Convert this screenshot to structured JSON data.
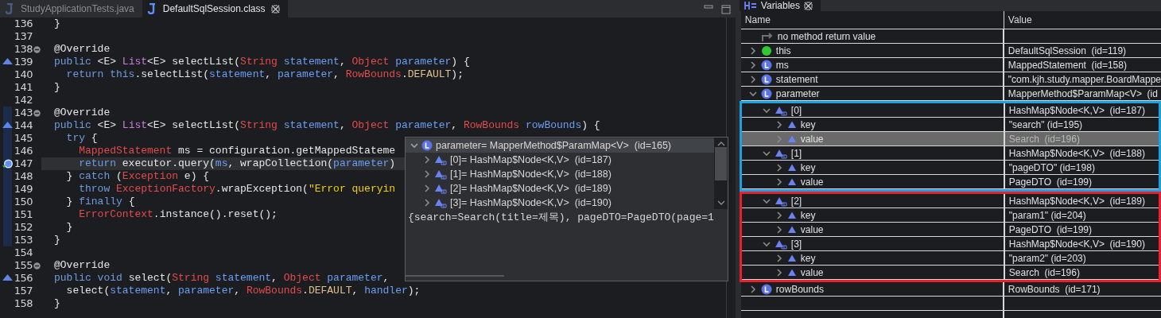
{
  "editor": {
    "tabs": [
      {
        "label": "StudyApplicationTests.java",
        "selected": false,
        "closable": false
      },
      {
        "label": "DefaultSqlSession.class",
        "selected": true,
        "closable": true
      }
    ],
    "lines": [
      {
        "number": "136",
        "fold": false,
        "scope": false,
        "current": false,
        "tokens": [
          {
            "kind": "plain",
            "text": "}"
          }
        ]
      },
      {
        "number": "137",
        "fold": false,
        "scope": false,
        "current": false
      },
      {
        "number": "138",
        "fold": true,
        "scope": false,
        "current": false,
        "tokens": [
          {
            "kind": "plain",
            "text": "@Override"
          }
        ]
      },
      {
        "number": "139",
        "fold": false,
        "marker": {
          "kind": "override"
        },
        "scope": false,
        "current": false,
        "tokens": [
          {
            "kind": "keyword",
            "text": "public"
          },
          {
            "kind": "plain",
            "text": " <E> "
          },
          {
            "kind": "generic",
            "text": "List"
          },
          {
            "kind": "plain",
            "text": "<E> selectList("
          },
          {
            "kind": "type",
            "text": "String"
          },
          {
            "kind": "variable",
            "text": " statement"
          },
          {
            "kind": "plain",
            "text": ", "
          },
          {
            "kind": "type",
            "text": "Object"
          },
          {
            "kind": "variable",
            "text": " parameter"
          },
          {
            "kind": "plain",
            "text": ") {"
          }
        ]
      },
      {
        "number": "140",
        "fold": false,
        "scope": false,
        "current": false,
        "tokens": [
          {
            "kind": "keyword",
            "text": "  return this"
          },
          {
            "kind": "plain",
            "text": ".selectList("
          },
          {
            "kind": "variable",
            "text": "statement"
          },
          {
            "kind": "plain",
            "text": ", "
          },
          {
            "kind": "variable",
            "text": "parameter"
          },
          {
            "kind": "plain",
            "text": ", "
          },
          {
            "kind": "type",
            "text": "RowBounds"
          },
          {
            "kind": "plain",
            "text": "."
          },
          {
            "kind": "constant",
            "text": "DEFAULT"
          },
          {
            "kind": "plain",
            "text": ");"
          }
        ]
      },
      {
        "number": "141",
        "fold": false,
        "scope": false,
        "current": false,
        "tokens": [
          {
            "kind": "plain",
            "text": "}"
          }
        ]
      },
      {
        "number": "142",
        "fold": false,
        "scope": false,
        "current": false
      },
      {
        "number": "143",
        "fold": true,
        "scope": true,
        "current": false,
        "tokens": [
          {
            "kind": "plain",
            "text": "@Override"
          }
        ]
      },
      {
        "number": "144",
        "fold": false,
        "marker": {
          "kind": "override"
        },
        "scope": true,
        "current": false,
        "tokens": [
          {
            "kind": "keyword",
            "text": "public"
          },
          {
            "kind": "plain",
            "text": " <E> "
          },
          {
            "kind": "generic",
            "text": "List"
          },
          {
            "kind": "plain",
            "text": "<E> selectList("
          },
          {
            "kind": "type",
            "text": "String"
          },
          {
            "kind": "variable",
            "text": " statement"
          },
          {
            "kind": "plain",
            "text": ", "
          },
          {
            "kind": "type",
            "text": "Object"
          },
          {
            "kind": "variable",
            "text": " parameter"
          },
          {
            "kind": "plain",
            "text": ", "
          },
          {
            "kind": "type",
            "text": "RowBounds"
          },
          {
            "kind": "variable",
            "text": " rowBounds"
          },
          {
            "kind": "plain",
            "text": ") {"
          }
        ]
      },
      {
        "number": "145",
        "fold": false,
        "scope": true,
        "current": false,
        "tokens": [
          {
            "kind": "keyword",
            "text": "  try"
          },
          {
            "kind": "plain",
            "text": " {"
          }
        ]
      },
      {
        "number": "146",
        "fold": false,
        "scope": true,
        "current": false,
        "tokens": [
          {
            "kind": "type",
            "text": "    MappedStatement"
          },
          {
            "kind": "plain",
            "text": " ms = configuration.getMappedStateme"
          }
        ]
      },
      {
        "number": "147",
        "fold": false,
        "marker": {
          "kind": "breakpoint"
        },
        "scope": true,
        "current": true,
        "tokens": [
          {
            "kind": "keyword",
            "text": "    return"
          },
          {
            "kind": "plain",
            "text": " executor.query("
          },
          {
            "kind": "variable",
            "text": "ms"
          },
          {
            "kind": "plain",
            "text": ", wrapCollection("
          },
          {
            "kind": "variable",
            "text": "parameter"
          },
          {
            "kind": "plain",
            "text": ")"
          }
        ]
      },
      {
        "number": "148",
        "fold": false,
        "scope": true,
        "current": false,
        "tokens": [
          {
            "kind": "plain",
            "text": "  } "
          },
          {
            "kind": "keyword",
            "text": "catch"
          },
          {
            "kind": "plain",
            "text": " ("
          },
          {
            "kind": "type",
            "text": "Exception"
          },
          {
            "kind": "plain",
            "text": " e) {"
          }
        ]
      },
      {
        "number": "149",
        "fold": false,
        "scope": true,
        "current": false,
        "tokens": [
          {
            "kind": "keyword",
            "text": "    throw"
          },
          {
            "kind": "type",
            "text": " ExceptionFactory"
          },
          {
            "kind": "plain",
            "text": ".wrapException("
          },
          {
            "kind": "string",
            "text": "\"Error queryin"
          }
        ]
      },
      {
        "number": "150",
        "fold": false,
        "scope": true,
        "current": false,
        "tokens": [
          {
            "kind": "plain",
            "text": "  } "
          },
          {
            "kind": "keyword",
            "text": "finally"
          },
          {
            "kind": "plain",
            "text": " {"
          }
        ]
      },
      {
        "number": "151",
        "fold": false,
        "scope": true,
        "current": false,
        "tokens": [
          {
            "kind": "type",
            "text": "    ErrorContext"
          },
          {
            "kind": "plain",
            "text": ".instance().reset();"
          }
        ]
      },
      {
        "number": "152",
        "fold": false,
        "scope": true,
        "current": false,
        "tokens": [
          {
            "kind": "plain",
            "text": "  }"
          }
        ]
      },
      {
        "number": "153",
        "fold": false,
        "scope": true,
        "current": false,
        "tokens": [
          {
            "kind": "plain",
            "text": "}"
          }
        ]
      },
      {
        "number": "154",
        "fold": false,
        "scope": false,
        "current": false
      },
      {
        "number": "155",
        "fold": true,
        "scope": false,
        "current": false,
        "tokens": [
          {
            "kind": "plain",
            "text": "@Override"
          }
        ]
      },
      {
        "number": "156",
        "fold": false,
        "marker": {
          "kind": "override"
        },
        "scope": false,
        "current": false,
        "tokens": [
          {
            "kind": "keyword",
            "text": "public void"
          },
          {
            "kind": "plain",
            "text": " select("
          },
          {
            "kind": "type",
            "text": "String"
          },
          {
            "kind": "variable",
            "text": " statement"
          },
          {
            "kind": "plain",
            "text": ", "
          },
          {
            "kind": "type",
            "text": "Object"
          },
          {
            "kind": "variable",
            "text": " parameter"
          },
          {
            "kind": "plain",
            "text": ","
          }
        ]
      },
      {
        "number": "157",
        "fold": false,
        "scope": false,
        "current": false,
        "tokens": [
          {
            "kind": "plain",
            "text": "  select("
          },
          {
            "kind": "variable",
            "text": "statement"
          },
          {
            "kind": "plain",
            "text": ", "
          },
          {
            "kind": "variable",
            "text": "parameter"
          },
          {
            "kind": "plain",
            "text": ", "
          },
          {
            "kind": "type",
            "text": "RowBounds"
          },
          {
            "kind": "plain",
            "text": "."
          },
          {
            "kind": "constant",
            "text": "DEFAULT"
          },
          {
            "kind": "plain",
            "text": ", "
          },
          {
            "kind": "variable",
            "text": "handler"
          },
          {
            "kind": "plain",
            "text": ");"
          }
        ]
      },
      {
        "number": "158",
        "fold": false,
        "scope": false,
        "current": false,
        "tokens": [
          {
            "kind": "plain",
            "text": "}"
          }
        ]
      }
    ],
    "hover": {
      "root": {
        "label": "parameter= MapperMethod$ParamMap<V>  (id=165)",
        "expanded": true,
        "selected": true
      },
      "entries": [
        {
          "label": "[0]= HashMap$Node<K,V>  (id=187)",
          "expanded": false,
          "selected": false
        },
        {
          "label": "[1]= HashMap$Node<K,V>  (id=188)",
          "expanded": false,
          "selected": false
        },
        {
          "label": "[2]= HashMap$Node<K,V>  (id=189)",
          "expanded": false,
          "selected": false
        },
        {
          "label": "[3]= HashMap$Node<K,V>  (id=190)",
          "expanded": false,
          "selected": false
        }
      ],
      "detail": "{search=Search(title=제목), pageDTO=PageDTO(page=1"
    }
  },
  "variables": {
    "tab": {
      "label": "Variables",
      "selected": true,
      "closable": true
    },
    "columns": [
      "Name",
      "Value"
    ],
    "rows": [
      {
        "kind": "return",
        "name": "no method return value",
        "selected": false
      },
      {
        "kind": "object",
        "name": "this",
        "value": "DefaultSqlSession  (id=119)",
        "expanded": false,
        "selected": false
      },
      {
        "kind": "local",
        "name": "ms",
        "value": "MappedStatement  (id=158)",
        "expanded": false,
        "selected": false
      },
      {
        "kind": "local",
        "name": "statement",
        "value": "\"com.kjh.study.mapper.BoardMappe",
        "expanded": false,
        "selected": false
      },
      {
        "kind": "local",
        "name": "parameter",
        "value": "MapperMethod$ParamMap<V>  (id",
        "expanded": true,
        "selected": false,
        "children": [
          {
            "kind": "entry",
            "name": "[0]",
            "value": "HashMap$Node<K,V>  (id=187)",
            "expanded": true,
            "selected": false,
            "color": "#1ba1e2",
            "children": [
              {
                "kind": "field",
                "name": "key",
                "value": "\"search\" (id=195)",
                "expanded": false,
                "selected": false
              },
              {
                "kind": "field",
                "name": "value",
                "value": "Search  (id=196)",
                "expanded": false,
                "selected": true
              }
            ]
          },
          {
            "kind": "entry",
            "name": "[1]",
            "value": "HashMap$Node<K,V>  (id=188)",
            "expanded": true,
            "selected": false,
            "color": "#1ba1e2",
            "children": [
              {
                "kind": "field",
                "name": "key",
                "value": "\"pageDTO\" (id=198)",
                "expanded": false,
                "selected": false
              },
              {
                "kind": "field",
                "name": "value",
                "value": "PageDTO  (id=199)",
                "expanded": false,
                "selected": false
              }
            ]
          },
          {
            "kind": "entry",
            "name": "[2]",
            "value": "HashMap$Node<K,V>  (id=189)",
            "expanded": true,
            "selected": false,
            "color": "#e8202a",
            "children": [
              {
                "kind": "field",
                "name": "key",
                "value": "\"param1\" (id=204)",
                "expanded": false,
                "selected": false
              },
              {
                "kind": "field",
                "name": "value",
                "value": "PageDTO  (id=199)",
                "expanded": false,
                "selected": false
              }
            ]
          },
          {
            "kind": "entry",
            "name": "[3]",
            "value": "HashMap$Node<K,V>  (id=190)",
            "expanded": true,
            "selected": false,
            "color": "#e8202a",
            "children": [
              {
                "kind": "field",
                "name": "key",
                "value": "\"param2\" (id=203)",
                "expanded": false,
                "selected": false
              },
              {
                "kind": "field",
                "name": "value",
                "value": "Search  (id=196)",
                "expanded": false,
                "selected": false
              }
            ]
          }
        ]
      },
      {
        "kind": "local",
        "name": "rowBounds",
        "value": "RowBounds  (id=171)",
        "expanded": false,
        "selected": false
      }
    ]
  }
}
